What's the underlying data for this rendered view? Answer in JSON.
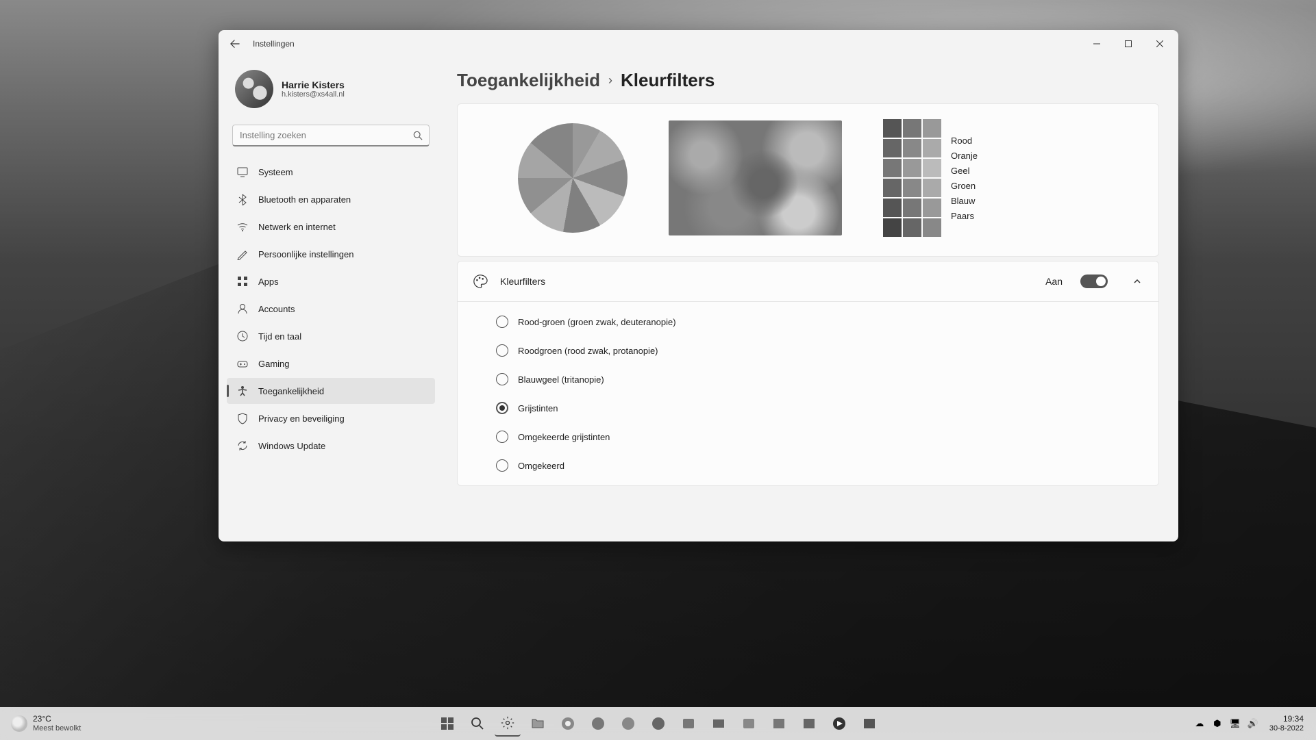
{
  "window": {
    "title": "Instellingen",
    "user": {
      "name": "Harrie Kisters",
      "email": "h.kisters@xs4all.nl"
    },
    "search_placeholder": "Instelling zoeken"
  },
  "sidebar": {
    "items": [
      {
        "label": "Systeem",
        "icon": "monitor"
      },
      {
        "label": "Bluetooth en apparaten",
        "icon": "bluetooth"
      },
      {
        "label": "Netwerk en internet",
        "icon": "wifi"
      },
      {
        "label": "Persoonlijke instellingen",
        "icon": "brush"
      },
      {
        "label": "Apps",
        "icon": "apps"
      },
      {
        "label": "Accounts",
        "icon": "person"
      },
      {
        "label": "Tijd en taal",
        "icon": "clock"
      },
      {
        "label": "Gaming",
        "icon": "gamepad"
      },
      {
        "label": "Toegankelijkheid",
        "icon": "accessibility",
        "active": true
      },
      {
        "label": "Privacy en beveiliging",
        "icon": "shield"
      },
      {
        "label": "Windows Update",
        "icon": "update"
      }
    ]
  },
  "breadcrumb": {
    "parent": "Toegankelijkheid",
    "current": "Kleurfilters"
  },
  "preview": {
    "color_labels": [
      "Rood",
      "Oranje",
      "Geel",
      "Groen",
      "Blauw",
      "Paars"
    ]
  },
  "toggle": {
    "label": "Kleurfilters",
    "state_text": "Aan",
    "on": true
  },
  "filter_options": [
    {
      "label": "Rood-groen (groen zwak, deuteranopie)",
      "selected": false
    },
    {
      "label": "Roodgroen (rood zwak, protanopie)",
      "selected": false
    },
    {
      "label": "Blauwgeel (tritanopie)",
      "selected": false
    },
    {
      "label": "Grijstinten",
      "selected": true
    },
    {
      "label": "Omgekeerde grijstinten",
      "selected": false
    },
    {
      "label": "Omgekeerd",
      "selected": false
    }
  ],
  "taskbar": {
    "weather": {
      "temp": "23°C",
      "condition": "Meest bewolkt"
    },
    "time": "19:34",
    "date": "30-8-2022"
  }
}
